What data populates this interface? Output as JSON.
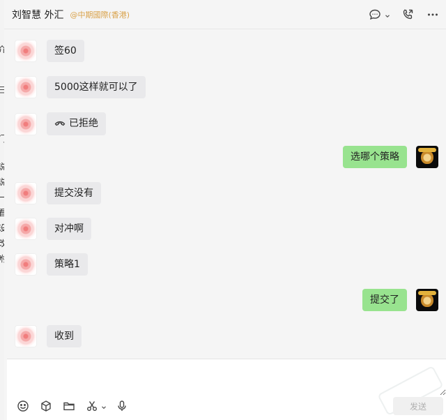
{
  "header": {
    "title": "刘智慧 外汇",
    "org": "@中期國際(香港)",
    "icons": [
      "chat-bubble-icon",
      "chevron-down-icon",
      "phone-icon",
      "more-icon"
    ]
  },
  "messages": [
    {
      "side": "left",
      "avatar": "flower",
      "text": "签60"
    },
    {
      "side": "left",
      "avatar": "flower",
      "text": "5000这样就可以了"
    },
    {
      "side": "left",
      "avatar": "flower",
      "text": "已拒绝",
      "icon": "hangup-icon"
    },
    {
      "side": "right",
      "avatar": "monkey",
      "text": "选哪个策略"
    },
    {
      "side": "left",
      "avatar": "flower",
      "text": "提交没有"
    },
    {
      "side": "left",
      "avatar": "flower",
      "text": "对冲啊"
    },
    {
      "side": "left",
      "avatar": "flower",
      "text": "策略1"
    },
    {
      "side": "right",
      "avatar": "monkey",
      "text": "提交了"
    },
    {
      "side": "left",
      "avatar": "flower",
      "text": "收到"
    }
  ],
  "composer": {
    "input_value": "",
    "tools": [
      "emoji-icon",
      "cube-icon",
      "folder-icon",
      "scissors-icon",
      "chevron-down-icon",
      "microphone-icon"
    ],
    "send_label": "发送"
  },
  "bleed_glyphs": [
    "介",
    "三",
    "门",
    "说",
    "说",
    "一",
    "看",
    "设",
    "改",
    "咐"
  ],
  "colors": {
    "bubble_left": "#e9e9eb",
    "bubble_right": "#98e38f",
    "org_label": "#d9a24a",
    "background": "#f5f5f5"
  }
}
